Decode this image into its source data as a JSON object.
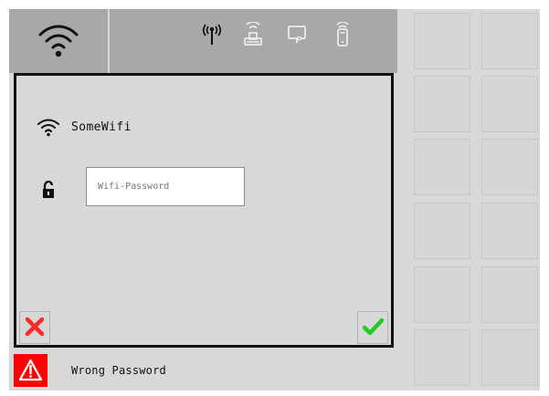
{
  "screen": {
    "title": ""
  },
  "top_bar": {
    "wifi_icon": "wifi-icon",
    "status_icons": [
      "antenna-icon",
      "modem-icon",
      "display-icon",
      "phone-icon"
    ]
  },
  "dialog": {
    "network_name": "SomeWifi",
    "password_placeholder": "Wifi-Password",
    "password_value": "",
    "lock_icon": "lock-icon",
    "cancel_icon": "close-icon",
    "confirm_icon": "check-icon"
  },
  "message": {
    "text": "Wrong Password",
    "warning_icon": "warning-icon"
  },
  "colors": {
    "background": "#d8d8d8",
    "top_bar": "#a8a8a8",
    "cancel": "#ff2b2b",
    "confirm": "#22cc22",
    "warning": "#ff0000"
  }
}
